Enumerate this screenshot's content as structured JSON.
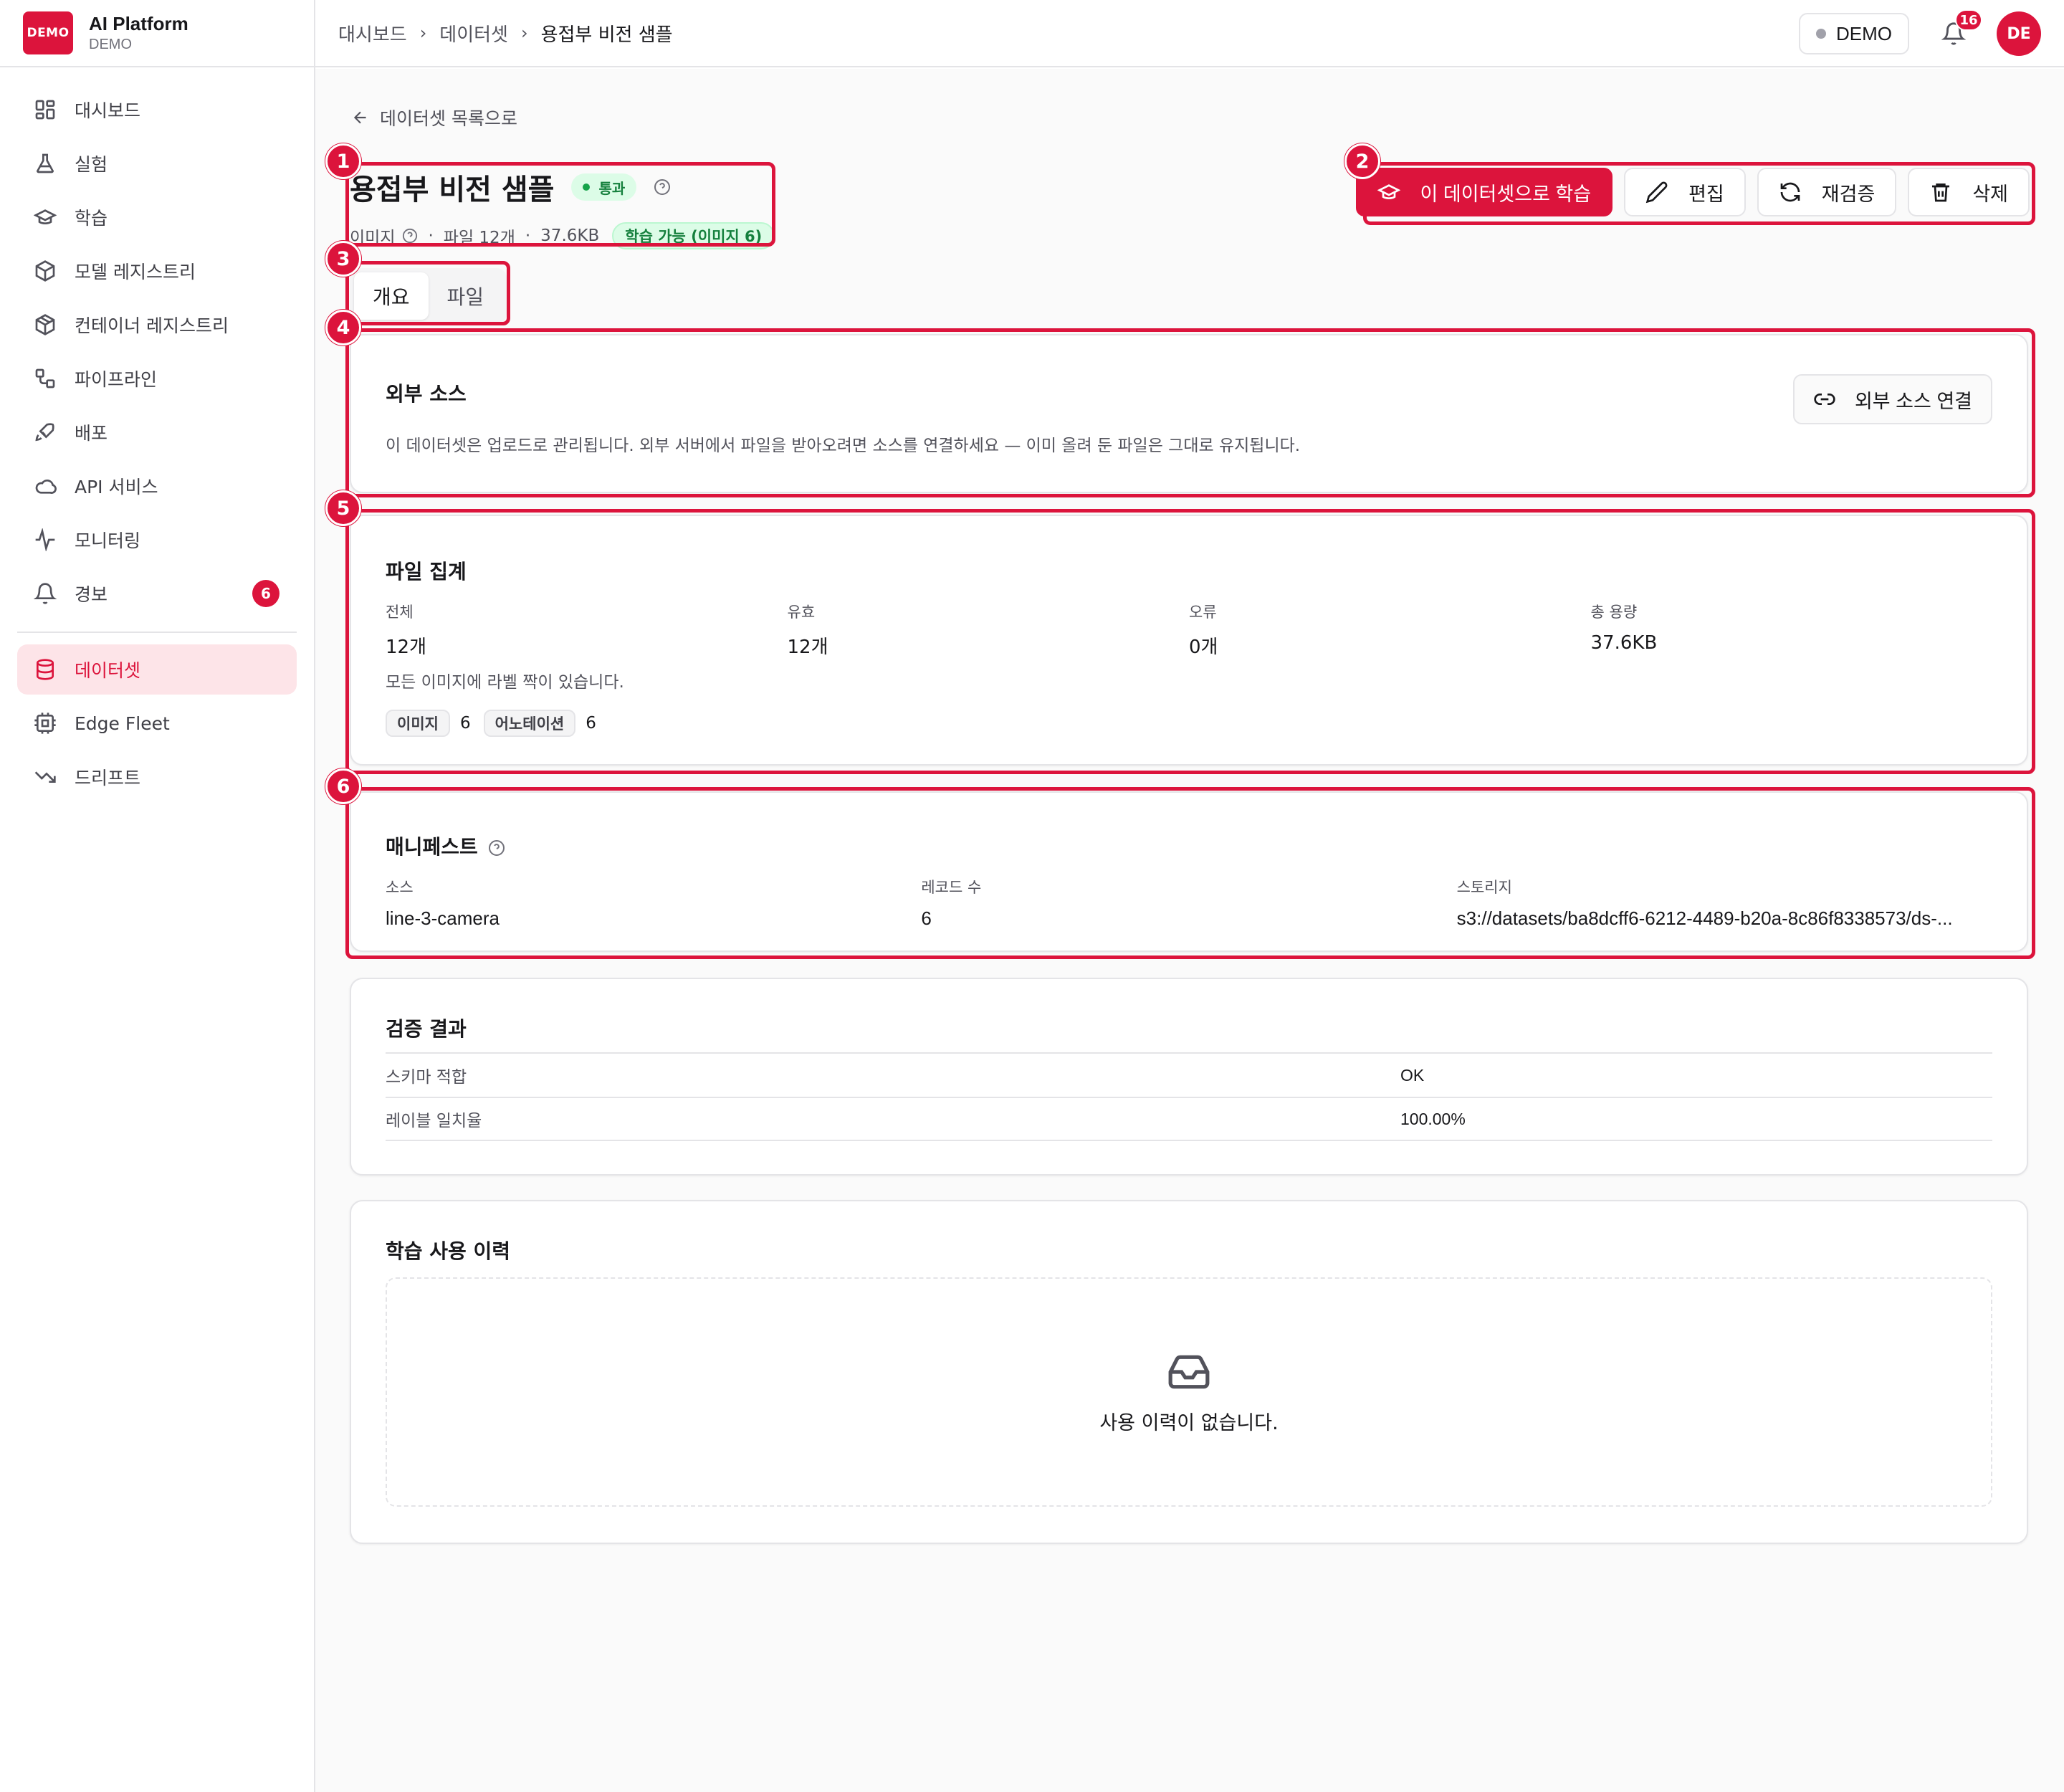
{
  "brand": {
    "logo_text": "DEMO",
    "title": "AI Platform",
    "subtitle": "DEMO"
  },
  "sidebar": {
    "items": [
      {
        "label": "대시보드",
        "icon": "dashboard-icon"
      },
      {
        "label": "실험",
        "icon": "flask-icon"
      },
      {
        "label": "학습",
        "icon": "graduation-cap-icon"
      },
      {
        "label": "모델 레지스트리",
        "icon": "cube-icon"
      },
      {
        "label": "컨테이너 레지스트리",
        "icon": "package-icon"
      },
      {
        "label": "파이프라인",
        "icon": "workflow-icon"
      },
      {
        "label": "배포",
        "icon": "rocket-icon"
      },
      {
        "label": "API 서비스",
        "icon": "cloud-icon"
      },
      {
        "label": "모니터링",
        "icon": "activity-icon"
      },
      {
        "label": "경보",
        "icon": "bell-icon",
        "badge": "6"
      }
    ],
    "items2": [
      {
        "label": "데이터셋",
        "icon": "database-icon",
        "active": true
      },
      {
        "label": "Edge Fleet",
        "icon": "edge-device-icon"
      },
      {
        "label": "드리프트",
        "icon": "trend-down-icon"
      }
    ]
  },
  "header": {
    "breadcrumb": [
      "대시보드",
      "데이터셋",
      "용접부 비전 샘플"
    ],
    "env_label": "DEMO",
    "notification_count": "16",
    "avatar_initials": "DE"
  },
  "page": {
    "back_label": "데이터셋 목록으로",
    "title": "용접부 비전 샘플",
    "status": "통과",
    "meta": {
      "type": "이미지",
      "files": "파일 12개",
      "size": "37.6KB",
      "trainable": "학습 가능 (이미지 6)"
    },
    "actions": {
      "train": "이 데이터셋으로 학습",
      "edit": "편집",
      "revalidate": "재검증",
      "delete": "삭제"
    },
    "tabs": [
      "개요",
      "파일"
    ]
  },
  "external_source": {
    "title": "외부 소스",
    "description": "이 데이터셋은 업로드로 관리됩니다. 외부 서버에서 파일을 받아오려면 소스를 연결하세요 — 이미 올려 둔 파일은 그대로 유지됩니다.",
    "connect_label": "외부 소스 연결"
  },
  "file_summary": {
    "title": "파일 집계",
    "stats": [
      {
        "label": "전체",
        "value": "12개"
      },
      {
        "label": "유효",
        "value": "12개"
      },
      {
        "label": "오류",
        "value": "0개"
      },
      {
        "label": "총 용량",
        "value": "37.6KB"
      }
    ],
    "note": "모든 이미지에 라벨 짝이 있습니다.",
    "chips": [
      {
        "label": "이미지",
        "count": "6"
      },
      {
        "label": "어노테이션",
        "count": "6"
      }
    ]
  },
  "manifest": {
    "title": "매니페스트",
    "fields": [
      {
        "label": "소스",
        "value": "line-3-camera"
      },
      {
        "label": "레코드 수",
        "value": "6"
      },
      {
        "label": "스토리지",
        "value": "s3://datasets/ba8dcff6-6212-4489-b20a-8c86f8338573/ds-..."
      }
    ]
  },
  "validation": {
    "title": "검증 결과",
    "rows": [
      {
        "label": "스키마 적합",
        "value": "OK"
      },
      {
        "label": "레이블 일치율",
        "value": "100.00%"
      }
    ]
  },
  "training_history": {
    "title": "학습 사용 이력",
    "empty_text": "사용 이력이 없습니다."
  },
  "annotations": [
    "1",
    "2",
    "3",
    "4",
    "5",
    "6"
  ],
  "colors": {
    "accent": "#dc143c",
    "success_bg": "#dcfce7",
    "success_text": "#15803d"
  }
}
